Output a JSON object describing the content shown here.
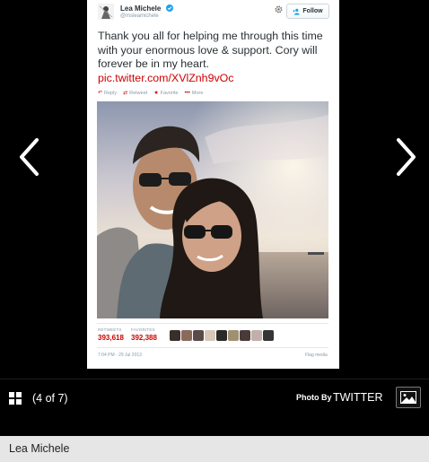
{
  "tweet": {
    "display_name": "Lea Michele",
    "handle": "@msleamichele",
    "follow_label": "Follow",
    "text": "Thank you all for helping me through this time with your enormous love & support. Cory will forever be in my heart.",
    "link": "pic.twitter.com/XVlZnh9vOc",
    "actions": [
      {
        "label": "Reply",
        "icon": "reply-icon"
      },
      {
        "label": "Retweet",
        "icon": "retweet-icon"
      },
      {
        "label": "Favorite",
        "icon": "star-icon"
      },
      {
        "label": "More",
        "icon": "more-icon"
      }
    ],
    "retweets_label": "RETWEETS",
    "retweets": "393,618",
    "favorites_label": "FAVORITES",
    "favorites": "392,388",
    "timestamp": "7:04 PM - 29 Jul 2013",
    "flag_label": "Flag media"
  },
  "gallery": {
    "counter": "(4 of 7)",
    "photo_by_label": "Photo By",
    "photo_credit": "TWITTER"
  },
  "caption": "Lea Michele",
  "colors": {
    "accent_red": "#cc0000",
    "verified_blue": "#1da1f2",
    "background": "#000000",
    "caption_bg": "#e6e6e6"
  }
}
